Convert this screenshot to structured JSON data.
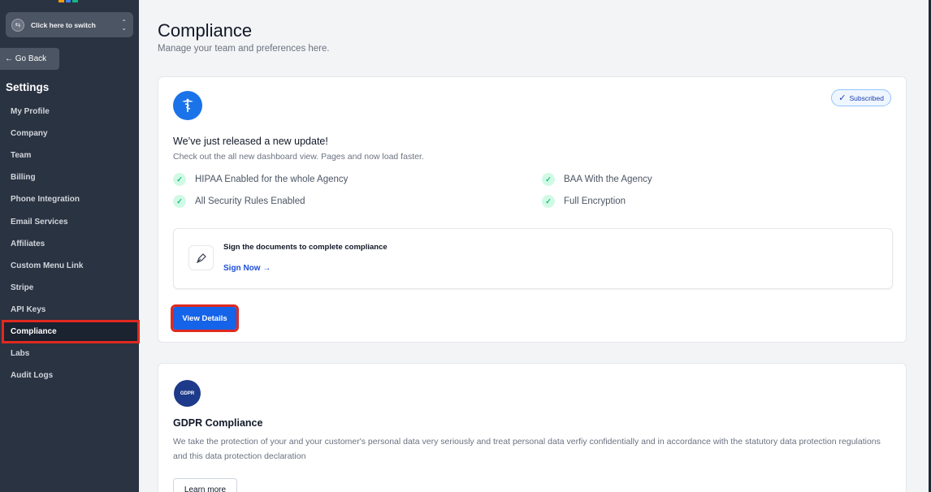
{
  "sidebar": {
    "switcher_label": "Click here to switch",
    "go_back_label": "← Go Back",
    "settings_title": "Settings",
    "items": [
      {
        "label": "My Profile"
      },
      {
        "label": "Company"
      },
      {
        "label": "Team"
      },
      {
        "label": "Billing"
      },
      {
        "label": "Phone Integration"
      },
      {
        "label": "Email Services"
      },
      {
        "label": "Affiliates"
      },
      {
        "label": "Custom Menu Link"
      },
      {
        "label": "Stripe"
      },
      {
        "label": "API Keys"
      },
      {
        "label": "Compliance"
      },
      {
        "label": "Labs"
      },
      {
        "label": "Audit Logs"
      }
    ],
    "active_item": "Compliance"
  },
  "main": {
    "title": "Compliance",
    "subtitle": "Manage your team and preferences here.",
    "hipaa_card": {
      "icon": "caduceus-icon",
      "badge": "Subscribed",
      "update_title": "We’ve just released a new update!",
      "update_subtitle": "Check out the all new dashboard view. Pages and now load faster.",
      "features": [
        "HIPAA Enabled for the whole Agency",
        "All Security Rules Enabled",
        "BAA With the Agency",
        "Full Encryption"
      ],
      "sign_text": "Sign the documents to complete compliance",
      "sign_link": "Sign Now →",
      "view_button": "View Details"
    },
    "gdpr_card": {
      "icon": "gdpr-eu-icon",
      "icon_text": "GDPR",
      "title": "GDPR Compliance",
      "description": "We take the protection of your and your customer's personal data very seriously and treat personal data verfiy confidentially and in accordance with the statutory data protection regulations and this data protection declaration",
      "button": "Learn more"
    }
  },
  "colors": {
    "sidebar_bg": "#2a3342",
    "accent": "#1563e8",
    "highlight": "#e0291f",
    "check": "#10b981"
  }
}
